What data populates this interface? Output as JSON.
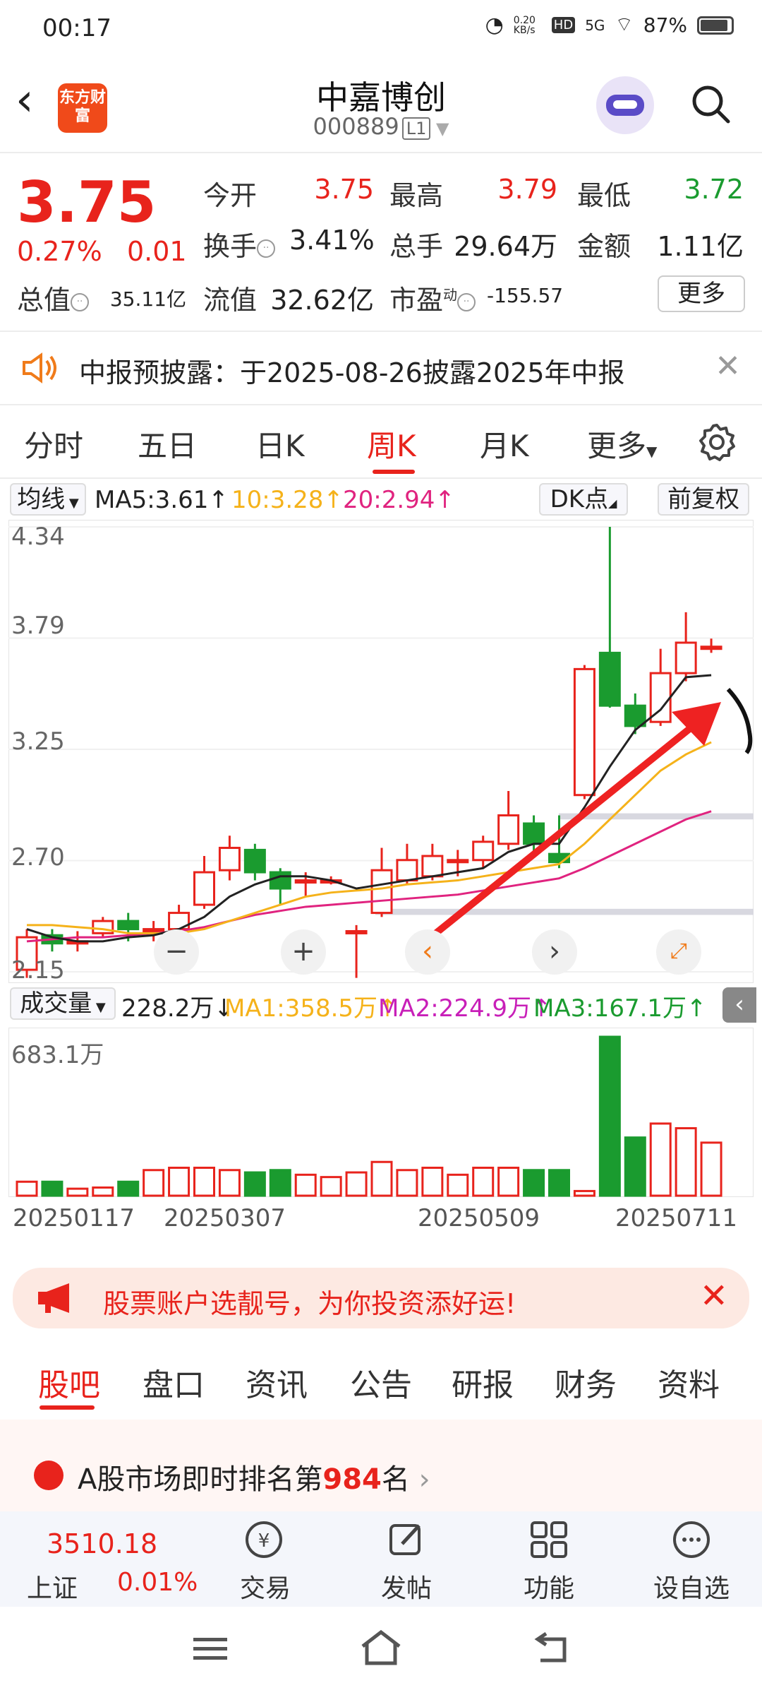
{
  "status": {
    "time": "00:17",
    "net_speed": "0.20 KB/s",
    "signal": "5G",
    "battery": "87%"
  },
  "header": {
    "logo_text": "东方财富",
    "stock_name": "中嘉博创",
    "stock_code": "000889",
    "level_tag": "L1"
  },
  "quote": {
    "price": "3.75",
    "change_pct": "0.27%",
    "change": "0.01",
    "open_label": "今开",
    "open": "3.75",
    "high_label": "最高",
    "high": "3.79",
    "low_label": "最低",
    "low": "3.72",
    "turnover_label": "换手",
    "turnover": "3.41%",
    "volume_label": "总手",
    "volume": "29.64万",
    "amount_label": "金额",
    "amount": "1.11亿",
    "mktcap_label": "总值",
    "mktcap": "35.11亿",
    "float_label": "流值",
    "float_cap": "32.62亿",
    "pe_label": "市盈",
    "pe_sup": "动",
    "pe": "-155.57",
    "more_label": "更多"
  },
  "notice": {
    "text": "中报预披露：于2025-08-26披露2025年中报"
  },
  "ktabs": [
    "分时",
    "五日",
    "日K",
    "周K",
    "月K",
    "更多"
  ],
  "ma": {
    "selector": "均线",
    "ma5": "MA5:3.61",
    "ma10": "10:3.28",
    "ma20": "20:2.94",
    "dk": "DK点",
    "fq": "前复权"
  },
  "chart_data": {
    "type": "candlestick",
    "y_ticks": [
      "4.34",
      "3.79",
      "3.25",
      "2.70",
      "2.15"
    ],
    "ylim": [
      2.15,
      4.34
    ],
    "candles": [
      {
        "o": 2.16,
        "c": 2.32,
        "h": 2.36,
        "l": 2.12
      },
      {
        "o": 2.33,
        "c": 2.29,
        "h": 2.36,
        "l": 2.25
      },
      {
        "o": 2.3,
        "c": 2.3,
        "h": 2.35,
        "l": 2.25
      },
      {
        "o": 2.34,
        "c": 2.4,
        "h": 2.42,
        "l": 2.32
      },
      {
        "o": 2.4,
        "c": 2.36,
        "h": 2.44,
        "l": 2.3
      },
      {
        "o": 2.36,
        "c": 2.36,
        "h": 2.4,
        "l": 2.3
      },
      {
        "o": 2.36,
        "c": 2.44,
        "h": 2.48,
        "l": 2.32
      },
      {
        "o": 2.48,
        "c": 2.64,
        "h": 2.72,
        "l": 2.46
      },
      {
        "o": 2.65,
        "c": 2.76,
        "h": 2.82,
        "l": 2.6
      },
      {
        "o": 2.75,
        "c": 2.64,
        "h": 2.78,
        "l": 2.6
      },
      {
        "o": 2.64,
        "c": 2.56,
        "h": 2.66,
        "l": 2.48
      },
      {
        "o": 2.6,
        "c": 2.6,
        "h": 2.64,
        "l": 2.52
      },
      {
        "o": 2.6,
        "c": 2.6,
        "h": 2.62,
        "l": 2.58
      },
      {
        "o": 2.35,
        "c": 2.35,
        "h": 2.38,
        "l": 2.12
      },
      {
        "o": 2.44,
        "c": 2.65,
        "h": 2.76,
        "l": 2.42
      },
      {
        "o": 2.6,
        "c": 2.7,
        "h": 2.78,
        "l": 2.58
      },
      {
        "o": 2.62,
        "c": 2.72,
        "h": 2.78,
        "l": 2.6
      },
      {
        "o": 2.7,
        "c": 2.7,
        "h": 2.75,
        "l": 2.62
      },
      {
        "o": 2.7,
        "c": 2.79,
        "h": 2.82,
        "l": 2.66
      },
      {
        "o": 2.78,
        "c": 2.92,
        "h": 3.04,
        "l": 2.75
      },
      {
        "o": 2.88,
        "c": 2.78,
        "h": 2.92,
        "l": 2.74
      },
      {
        "o": 2.73,
        "c": 2.69,
        "h": 2.92,
        "l": 2.66
      },
      {
        "o": 3.02,
        "c": 3.64,
        "h": 3.66,
        "l": 3.0
      },
      {
        "o": 3.72,
        "c": 3.46,
        "h": 4.34,
        "l": 3.45
      },
      {
        "o": 3.46,
        "c": 3.36,
        "h": 3.52,
        "l": 3.32
      },
      {
        "o": 3.38,
        "c": 3.62,
        "h": 3.74,
        "l": 3.36
      },
      {
        "o": 3.62,
        "c": 3.77,
        "h": 3.92,
        "l": 3.58
      },
      {
        "o": 3.74,
        "c": 3.75,
        "h": 3.79,
        "l": 3.72
      }
    ],
    "ma5": [
      2.36,
      2.32,
      2.3,
      2.3,
      2.32,
      2.33,
      2.36,
      2.42,
      2.52,
      2.58,
      2.62,
      2.62,
      2.6,
      2.56,
      2.58,
      2.6,
      2.62,
      2.64,
      2.66,
      2.74,
      2.78,
      2.78,
      2.96,
      3.16,
      3.34,
      3.44,
      3.6,
      3.61
    ],
    "ma10": [
      2.38,
      2.38,
      2.37,
      2.36,
      2.34,
      2.34,
      2.34,
      2.36,
      2.4,
      2.44,
      2.48,
      2.52,
      2.54,
      2.55,
      2.56,
      2.58,
      2.59,
      2.6,
      2.62,
      2.64,
      2.66,
      2.68,
      2.78,
      2.9,
      3.02,
      3.14,
      3.22,
      3.28
    ],
    "ma20": [
      2.3,
      2.31,
      2.32,
      2.32,
      2.33,
      2.34,
      2.35,
      2.37,
      2.4,
      2.43,
      2.45,
      2.47,
      2.48,
      2.49,
      2.5,
      2.51,
      2.52,
      2.53,
      2.55,
      2.57,
      2.59,
      2.61,
      2.66,
      2.72,
      2.78,
      2.84,
      2.9,
      2.94
    ]
  },
  "volume": {
    "selector": "成交量",
    "current": "228.2万",
    "ma1": "MA1:358.5万",
    "ma2": "MA2:224.9万",
    "ma3": "MA3:167.1万",
    "max_label": "683.1万",
    "values": [
      60,
      60,
      30,
      35,
      60,
      110,
      120,
      120,
      110,
      100,
      110,
      90,
      80,
      100,
      145,
      110,
      120,
      90,
      120,
      120,
      110,
      110,
      20,
      683,
      250,
      310,
      290,
      228
    ]
  },
  "dates": [
    "20250117",
    "20250307",
    "20250509",
    "20250711"
  ],
  "ad": {
    "text": "股票账户选靓号，为你投资添好运!"
  },
  "btabs": [
    "股吧",
    "盘口",
    "资讯",
    "公告",
    "研报",
    "财务",
    "资料"
  ],
  "rank": {
    "prefix": "A股市场即时排名第",
    "num": "984",
    "suffix": "名"
  },
  "bnav": {
    "index_name": "上证",
    "index_value": "3510.18",
    "index_chg": "0.01%",
    "items": [
      "交易",
      "发帖",
      "功能",
      "设自选"
    ]
  },
  "colors": {
    "up": "#e8231c",
    "down": "#1a9b2f",
    "ma5": "#222222",
    "ma10": "#f5b21a",
    "ma20": "#e0237f"
  }
}
